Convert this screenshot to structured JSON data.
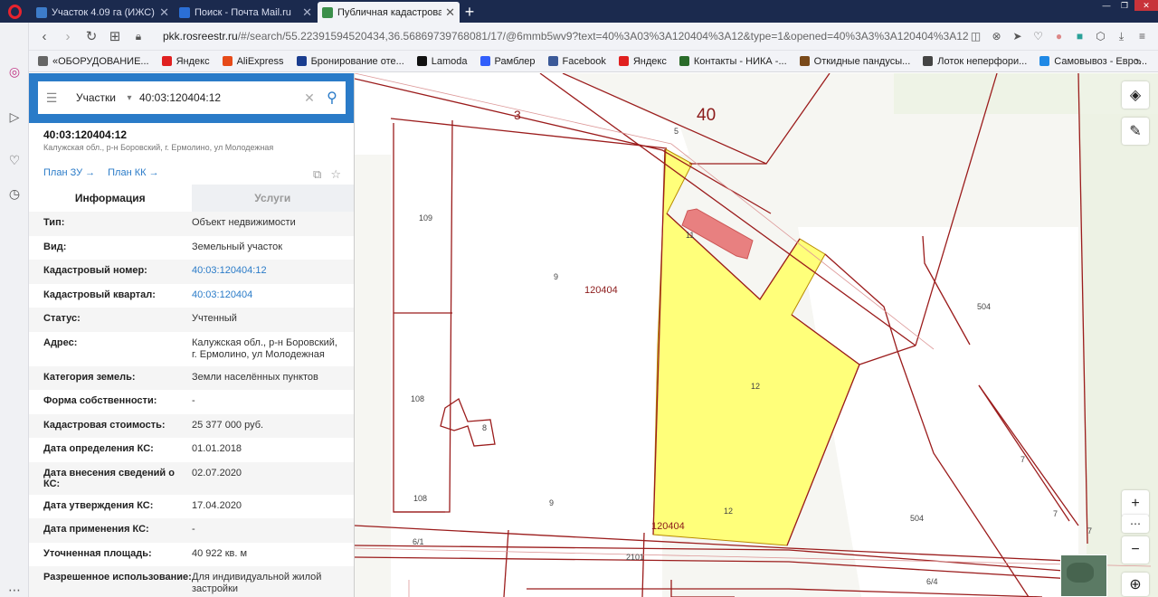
{
  "browser": {
    "tabs": [
      {
        "title": "Участок 4.09 га (ИЖС) — ",
        "active": false,
        "favicon_color": "#3d7cc9"
      },
      {
        "title": "Поиск - Почта Mail.ru",
        "active": false,
        "favicon_color": "#2b6fd6"
      },
      {
        "title": "Публичная кадастровая к",
        "active": true,
        "favicon_color": "#3b8f4a"
      }
    ],
    "new_tab": "+",
    "url_prefix": "pkk.rosreestr.ru",
    "url_rest": "/#/search/55.22391594520434,36.56869739768081/17/@6mmb5wv9?text=40%3A03%3A120404%3A12&type=1&opened=40%3A3%3A120404%3A12",
    "bookmarks": [
      {
        "label": "«ОБОРУДОВАНИЕ...",
        "color": "#666"
      },
      {
        "label": "Яндекс",
        "color": "#e02020"
      },
      {
        "label": "AliExpress",
        "color": "#e64a19"
      },
      {
        "label": "Бронирование оте...",
        "color": "#1a3d8f"
      },
      {
        "label": "Lamoda",
        "color": "#111"
      },
      {
        "label": "Рамблер",
        "color": "#315efb"
      },
      {
        "label": "Facebook",
        "color": "#3b5998"
      },
      {
        "label": "Яндекс",
        "color": "#e02020"
      },
      {
        "label": "Контакты - НИКА -...",
        "color": "#2a6b2a"
      },
      {
        "label": "Откидные пандусы...",
        "color": "#7a4a1a"
      },
      {
        "label": "Лоток неперфори...",
        "color": "#444"
      },
      {
        "label": "Самовывоз - Евро...",
        "color": "#1e88e5"
      }
    ],
    "bookmarks_more": "»"
  },
  "search": {
    "type": "Участки",
    "query": "40:03:120404:12"
  },
  "object": {
    "number": "40:03:120404:12",
    "address": "Калужская обл., р-н Боровский, г. Ермолино, ул Молодежная",
    "plan_zu": "План ЗУ →",
    "plan_kk": "План КК →"
  },
  "tabs": {
    "info": "Информация",
    "services": "Услуги"
  },
  "rows": [
    {
      "k": "Тип:",
      "v": "Объект недвижимости",
      "link": false
    },
    {
      "k": "Вид:",
      "v": "Земельный участок",
      "link": false
    },
    {
      "k": "Кадастровый номер:",
      "v": "40:03:120404:12",
      "link": true
    },
    {
      "k": "Кадастровый квартал:",
      "v": "40:03:120404",
      "link": true
    },
    {
      "k": "Статус:",
      "v": "Учтенный",
      "link": false
    },
    {
      "k": "Адрес:",
      "v": "Калужская обл., р-н Боровский, г. Ермолино, ул Молодежная",
      "link": false
    },
    {
      "k": "Категория земель:",
      "v": "Земли населённых пунктов",
      "link": false
    },
    {
      "k": "Форма собственности:",
      "v": "-",
      "link": false
    },
    {
      "k": "Кадастровая стоимость:",
      "v": "25 377 000 руб.",
      "link": false
    },
    {
      "k": "Дата определения КС:",
      "v": "01.01.2018",
      "link": false
    },
    {
      "k": "Дата внесения сведений о КС:",
      "v": "02.07.2020",
      "link": false
    },
    {
      "k": "Дата утверждения КС:",
      "v": "17.04.2020",
      "link": false
    },
    {
      "k": "Дата применения КС:",
      "v": "-",
      "link": false
    },
    {
      "k": "Уточненная площадь:",
      "v": "40 922 кв. м",
      "link": false
    },
    {
      "k": "Разрешенное использование:",
      "v": "Для индивидуальной жилой застройки",
      "link": false
    }
  ],
  "map_labels": [
    {
      "id": "40",
      "text": "40"
    },
    {
      "id": "3",
      "text": "3"
    },
    {
      "id": "5",
      "text": "5"
    },
    {
      "id": "109",
      "text": "109"
    },
    {
      "id": "9a",
      "text": "9"
    },
    {
      "id": "120404a",
      "text": "120404"
    },
    {
      "id": "11",
      "text": "11"
    },
    {
      "id": "12a",
      "text": "12"
    },
    {
      "id": "504a",
      "text": "504"
    },
    {
      "id": "108a",
      "text": "108"
    },
    {
      "id": "8",
      "text": "8"
    },
    {
      "id": "108b",
      "text": "108"
    },
    {
      "id": "9b",
      "text": "9"
    },
    {
      "id": "12b",
      "text": "12"
    },
    {
      "id": "120404b",
      "text": "120404"
    },
    {
      "id": "504b",
      "text": "504"
    },
    {
      "id": "7a",
      "text": "7"
    },
    {
      "id": "7b",
      "text": "7"
    },
    {
      "id": "7c",
      "text": "7"
    },
    {
      "id": "6_1",
      "text": "6/1"
    },
    {
      "id": "2101",
      "text": "2101"
    },
    {
      "id": "6_4",
      "text": "6/4"
    }
  ],
  "colors": {
    "accent_blue": "#2a7bc8",
    "parcel_line": "#9b1c1c",
    "selected_fill": "#ffff78",
    "building": "#e57373"
  }
}
